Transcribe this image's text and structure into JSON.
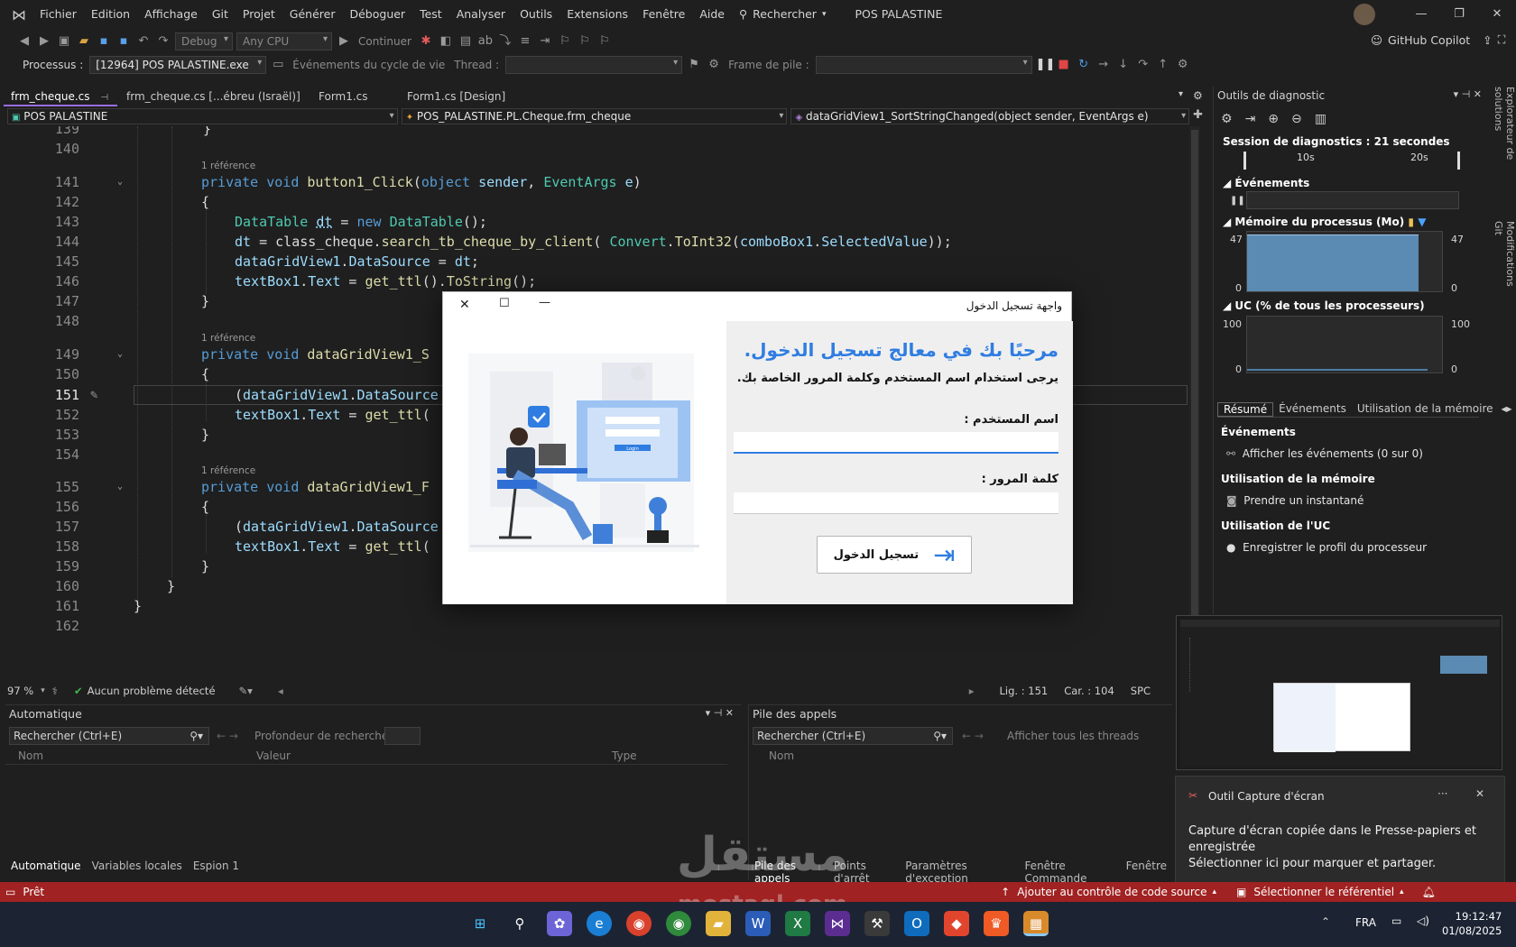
{
  "menu": {
    "items": [
      "Fichier",
      "Edition",
      "Affichage",
      "Git",
      "Projet",
      "Générer",
      "Déboguer",
      "Test",
      "Analyser",
      "Outils",
      "Extensions",
      "Fenêtre",
      "Aide"
    ],
    "search": "Rechercher",
    "project": "POS PALASTINE",
    "copilot": "GitHub Copilot"
  },
  "toolbar": {
    "config": "Debug",
    "platform": "Any CPU",
    "continue": "Continuer",
    "process_label": "Processus :",
    "process_value": "[12964] POS PALASTINE.exe",
    "lifecycle": "Événements du cycle de vie",
    "thread": "Thread :",
    "stackframe": "Frame de pile :"
  },
  "tabs": [
    {
      "label": "frm_cheque.cs",
      "active": true
    },
    {
      "label": "frm_cheque.cs [...ébreu (Israël)]",
      "active": false
    },
    {
      "label": "Form1.cs",
      "active": false
    },
    {
      "label": "Form1.cs [Design]",
      "active": false
    }
  ],
  "nav": {
    "project": "POS PALASTINE",
    "class": "POS_PALASTINE.PL.Cheque.frm_cheque",
    "member": "dataGridView1_SortStringChanged(object sender, EventArgs e)"
  },
  "editor": {
    "refs_label": "1 référence",
    "lines": [
      {
        "n": "139",
        "code": "}"
      },
      {
        "n": "140",
        "code": ""
      },
      {
        "n": "141",
        "code": "private void button1_Click(object sender, EventArgs e)"
      },
      {
        "n": "142",
        "code": "{"
      },
      {
        "n": "143",
        "code": "DataTable dt = new DataTable();"
      },
      {
        "n": "144",
        "code": "dt = class_cheque.search_tb_cheque_by_client( Convert.ToInt32(comboBox1.SelectedValue));"
      },
      {
        "n": "145",
        "code": "dataGridView1.DataSource = dt;"
      },
      {
        "n": "146",
        "code": "textBox1.Text = get_ttl().ToString();"
      },
      {
        "n": "147",
        "code": "}"
      },
      {
        "n": "148",
        "code": ""
      },
      {
        "n": "149",
        "code": "private void dataGridView1_S"
      },
      {
        "n": "150",
        "code": "{"
      },
      {
        "n": "151",
        "code": "(dataGridView1.DataSource"
      },
      {
        "n": "152",
        "code": "textBox1.Text = get_ttl("
      },
      {
        "n": "153",
        "code": "}"
      },
      {
        "n": "154",
        "code": ""
      },
      {
        "n": "155",
        "code": "private void dataGridView1_F"
      },
      {
        "n": "156",
        "code": "{"
      },
      {
        "n": "157",
        "code": "(dataGridView1.DataSource"
      },
      {
        "n": "158",
        "code": "textBox1.Text = get_ttl("
      },
      {
        "n": "159",
        "code": "}"
      },
      {
        "n": "160",
        "code": "}"
      },
      {
        "n": "161",
        "code": "}"
      },
      {
        "n": "162",
        "code": ""
      }
    ]
  },
  "editor_status": {
    "zoom": "97 %",
    "problems": "Aucun problème détecté",
    "line": "Lig. : 151",
    "col": "Car. : 104",
    "mode": "SPC"
  },
  "autos": {
    "title": "Automatique",
    "search": "Rechercher (Ctrl+E)",
    "depth": "Profondeur de recherche :",
    "cols": [
      "Nom",
      "Valeur",
      "Type"
    ],
    "tabs": [
      "Automatique",
      "Variables locales",
      "Espion 1"
    ]
  },
  "callstack": {
    "title": "Pile des appels",
    "search": "Rechercher (Ctrl+E)",
    "threads": "Afficher tous les threads",
    "cols": [
      "Nom"
    ],
    "tabs": [
      "Pile des appels",
      "Points d'arrêt",
      "Paramètres d'exception",
      "Fenêtre Commande",
      "Fenêtre"
    ]
  },
  "diag": {
    "title": "Outils de diagnostic",
    "session": "Session de diagnostics : 21 secondes",
    "t10": "10s",
    "t20": "20s",
    "events": "Événements",
    "memory": "Mémoire du processus (Mo)",
    "mem_max": "47",
    "mem_min": "0",
    "mem_level": 0.95,
    "cpu": "UC (% de tous les processeurs)",
    "cpu_max": "100",
    "cpu_min": "0",
    "tabs": [
      "Résumé",
      "Événements",
      "Utilisation de la mémoire"
    ],
    "sec_events": "Événements",
    "show_events": "Afficher les événements (0 sur 0)",
    "sec_memory": "Utilisation de la mémoire",
    "snapshot": "Prendre un instantané",
    "sec_cpu": "Utilisation de l'UC",
    "cpu_profile": "Enregistrer le profil du processeur",
    "side1": "Explorateur de solutions",
    "side2": "Modifications Git"
  },
  "dialog": {
    "title": "واجهة تسجيل الدخول",
    "welcome": "مرحبًا بك في معالج تسجيل الدخول.",
    "subtitle": "يرجى استخدام اسم المستخدم وكلمة المرور الخاصة بك.",
    "user_label": "اسم المستخدم :",
    "pass_label": "كلمة المرور :",
    "login_button": "تسجيل الدخول",
    "illus_login": "Login"
  },
  "notification": {
    "app": "Outil Capture d'écran",
    "line1": "Capture d'écran copiée dans le Presse-papiers et enregistrée",
    "line2": "Sélectionner ici pour marquer et partager."
  },
  "statusbar": {
    "ready": "Prêt",
    "source_control": "Ajouter au contrôle de code source",
    "repo": "Sélectionner le référentiel"
  },
  "watermark": {
    "ar": "مستقل",
    "en": "mostaql.com"
  },
  "taskbar": {
    "lang": "FRA",
    "time": "19:12:47",
    "date": "01/08/2025"
  }
}
